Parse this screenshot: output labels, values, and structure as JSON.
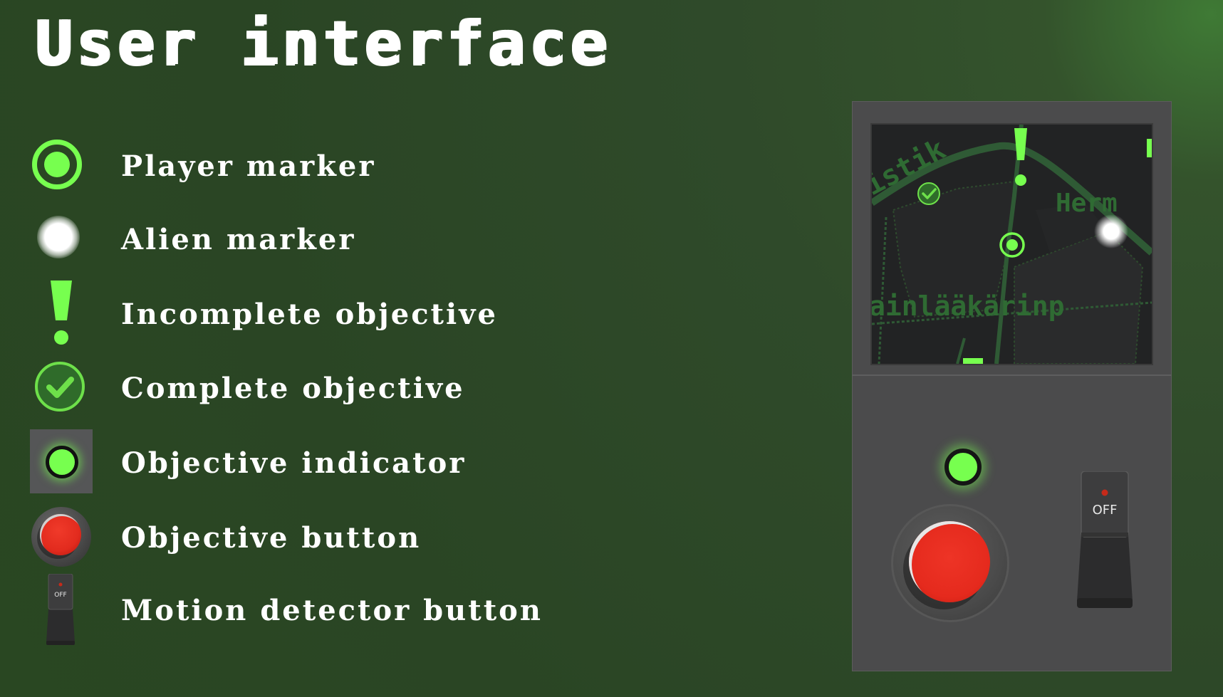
{
  "page": {
    "title": "User interface"
  },
  "legend": {
    "player_marker": "Player marker",
    "alien_marker": "Alien marker",
    "incomplete_objective": "Incomplete objective",
    "complete_objective": "Complete objective",
    "objective_indicator": "Objective indicator",
    "objective_button": "Objective button",
    "motion_detector_button": "Motion detector button"
  },
  "device": {
    "switch_label": "OFF",
    "map_labels": {
      "street_top": "istik",
      "street_right": "Herm",
      "street_bottom": "ainlääkärinp"
    }
  },
  "colors": {
    "accent_green": "#77ff4f",
    "button_red": "#e52a1d",
    "panel_gray": "#4b4b4c",
    "background": "#2f4a2a"
  }
}
